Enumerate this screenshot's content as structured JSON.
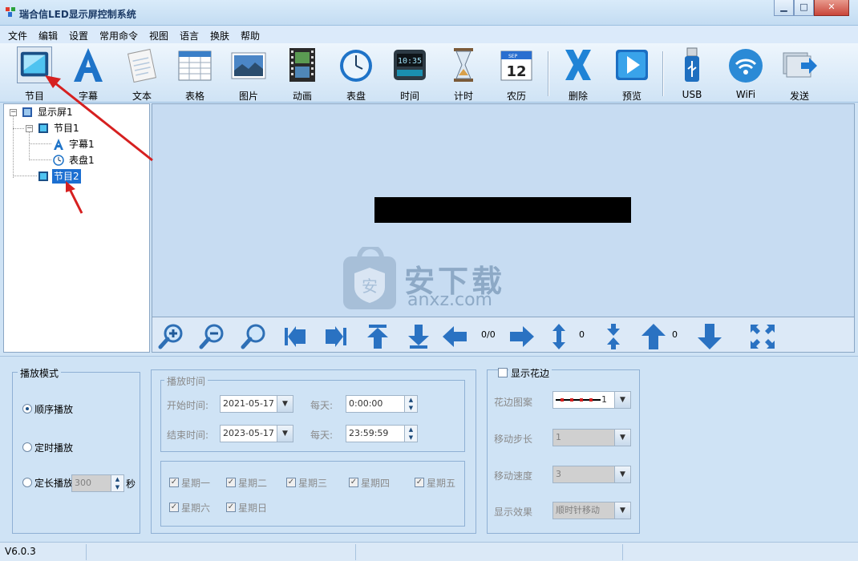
{
  "window": {
    "title": "瑞合信LED显示屏控制系统",
    "minimize": "▁",
    "maximize": "□",
    "close": "✕"
  },
  "menu": [
    "文件",
    "编辑",
    "设置",
    "常用命令",
    "视图",
    "语言",
    "换肤",
    "帮助"
  ],
  "toolbar": [
    {
      "label": "节目",
      "icon": "program-icon"
    },
    {
      "label": "字幕",
      "icon": "subtitle-icon"
    },
    {
      "label": "文本",
      "icon": "text-icon"
    },
    {
      "label": "表格",
      "icon": "table-icon"
    },
    {
      "label": "图片",
      "icon": "picture-icon"
    },
    {
      "label": "动画",
      "icon": "animation-icon"
    },
    {
      "label": "表盘",
      "icon": "clock-dial-icon"
    },
    {
      "label": "时间",
      "icon": "digital-clock-icon"
    },
    {
      "label": "计时",
      "icon": "hourglass-icon"
    },
    {
      "label": "农历",
      "icon": "calendar-icon"
    },
    {
      "label": "删除",
      "icon": "delete-icon"
    },
    {
      "label": "预览",
      "icon": "preview-icon"
    },
    {
      "label": "USB",
      "icon": "usb-icon"
    },
    {
      "label": "WiFi",
      "icon": "wifi-icon"
    },
    {
      "label": "发送",
      "icon": "send-icon"
    }
  ],
  "calendar_icon": {
    "month": "SEP",
    "day": "12"
  },
  "digital_clock_icon": {
    "time": "10:35"
  },
  "tree": {
    "root": "显示屏1",
    "program1": "节目1",
    "subtitle1": "字幕1",
    "dial1": "表盘1",
    "program2": "节目2"
  },
  "watermark": {
    "text": "安下载",
    "sub": "anxz.com",
    "badge": "安"
  },
  "navbar": {
    "page_count": "0/0",
    "vertical_value": "0",
    "up_value": "0"
  },
  "play_mode": {
    "title": "播放模式",
    "sequential": "顺序播放",
    "timed": "定时播放",
    "fixed_length": "定长播放",
    "duration_value": "300",
    "seconds_unit": "秒"
  },
  "schedule": {
    "title": "播放时间",
    "start_label": "开始时间:",
    "start_date": "2021-05-17",
    "daily_label_1": "每天:",
    "daily_start": "0:00:00",
    "end_label": "结束时间:",
    "end_date": "2023-05-17",
    "daily_label_2": "每天:",
    "daily_end": "23:59:59",
    "weekdays": [
      "星期一",
      "星期二",
      "星期三",
      "星期四",
      "星期五",
      "星期六",
      "星期日"
    ]
  },
  "border": {
    "title": "显示花边",
    "pattern_label": "花边图案",
    "pattern_value": "1",
    "step_label": "移动步长",
    "step_value": "1",
    "speed_label": "移动速度",
    "speed_value": "3",
    "effect_label": "显示效果",
    "effect_value": "顺时针移动"
  },
  "status": {
    "version": "V6.0.3"
  },
  "colors": {
    "accent": "#1c6fd1",
    "annotation_arrow": "#d62020",
    "panel": "#cfe3f5"
  }
}
